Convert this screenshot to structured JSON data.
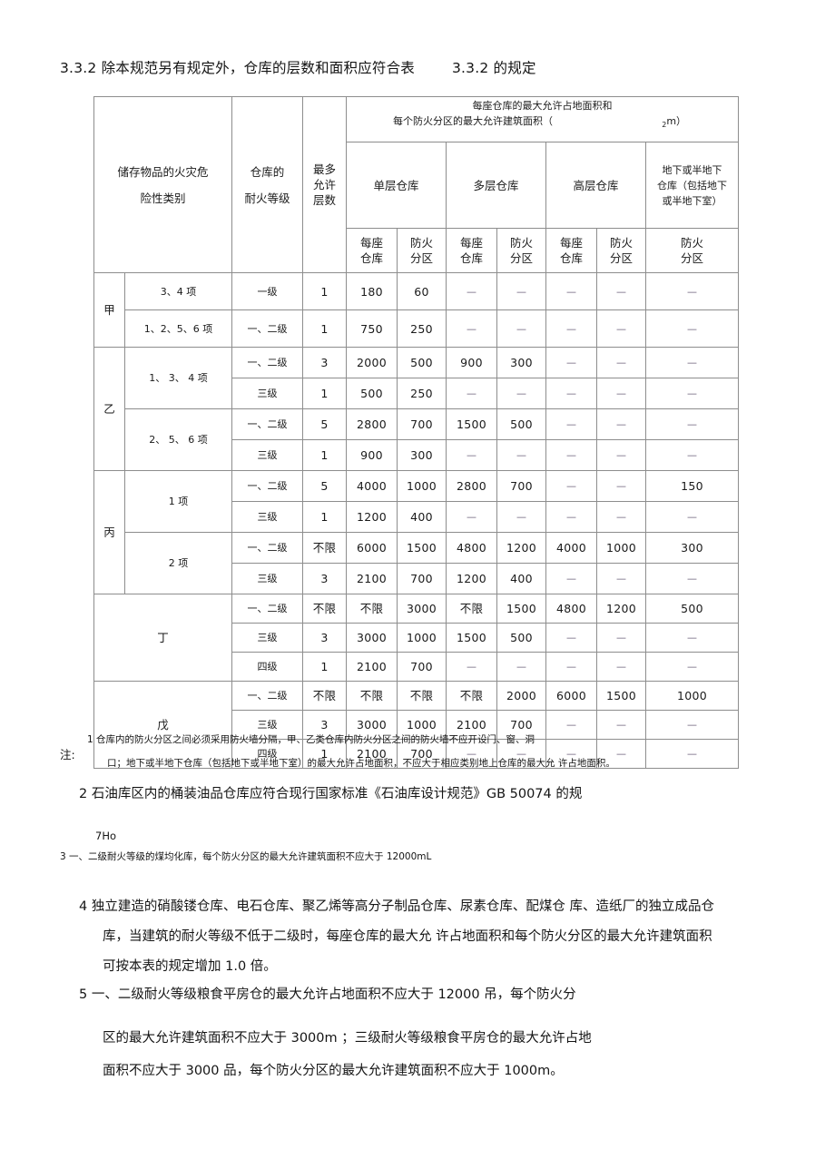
{
  "document": {
    "clause_heading": "3.3.2 除本规范另有规定外，仓库的层数和面积应符合表        3.3.2 的规定"
  },
  "table": {
    "headers": {
      "col_hazard": "储存物品的火灾危\n险性类别",
      "col_hazard_line1": "储存物品的火灾危",
      "col_hazard_line2": "险性类别",
      "col_fire_rating_line1": "仓库的",
      "col_fire_rating_line2": "耐火等级",
      "col_max_floors_line1": "最多",
      "col_max_floors_line2": "允许",
      "col_max_floors_line3": "层数",
      "group_title_line1": "每座仓库的最大允许占地面积和",
      "group_title_line2_a": "每个防火分区的最大允许建筑面积（",
      "group_title_line2_sup": "2",
      "group_title_line2_b": "m）",
      "sub_single": "单层仓库",
      "sub_multi": "多层仓库",
      "sub_high": "高层仓库",
      "sub_basement_line1": "地下或半地下",
      "sub_basement_line2": "仓库（包括地下",
      "sub_basement_line3": "或半地下室）",
      "leaf_each_line1": "每座",
      "leaf_each_line2": "仓库",
      "leaf_zone_line1": "防火",
      "leaf_zone_line2": "分区"
    },
    "groups": [
      {
        "category": "甲",
        "subrows": [
          {
            "items": "3、4 项",
            "items_rowspan": 1,
            "grade": "一级",
            "floors": "1",
            "single_each": "180",
            "single_zone": "60",
            "multi_each": "—",
            "multi_zone": "—",
            "high_each": "—",
            "high_zone": "—",
            "basement_zone": "—"
          },
          {
            "items": "1、2、5、6 项",
            "items_rowspan": 1,
            "grade": "一、二级",
            "floors": "1",
            "single_each": "750",
            "single_zone": "250",
            "multi_each": "—",
            "multi_zone": "—",
            "high_each": "—",
            "high_zone": "—",
            "basement_zone": "—"
          }
        ]
      },
      {
        "category": "乙",
        "subrows": [
          {
            "items": "1、 3、 4 项",
            "items_rowspan": 2,
            "grade": "一、二级",
            "floors": "3",
            "single_each": "2000",
            "single_zone": "500",
            "multi_each": "900",
            "multi_zone": "300",
            "high_each": "—",
            "high_zone": "—",
            "basement_zone": "—"
          },
          {
            "grade": "三级",
            "floors": "1",
            "single_each": "500",
            "single_zone": "250",
            "multi_each": "—",
            "multi_zone": "—",
            "high_each": "—",
            "high_zone": "—",
            "basement_zone": "—"
          },
          {
            "items": "2、 5、 6 项",
            "items_rowspan": 2,
            "grade": "一、二级",
            "floors": "5",
            "single_each": "2800",
            "single_zone": "700",
            "multi_each": "1500",
            "multi_zone": "500",
            "high_each": "—",
            "high_zone": "—",
            "basement_zone": "—"
          },
          {
            "grade": "三级",
            "floors": "1",
            "single_each": "900",
            "single_zone": "300",
            "multi_each": "—",
            "multi_zone": "—",
            "high_each": "—",
            "high_zone": "—",
            "basement_zone": "—"
          }
        ]
      },
      {
        "category": "丙",
        "subrows": [
          {
            "items": "1 项",
            "items_rowspan": 2,
            "grade": "一、二级",
            "floors": "5",
            "single_each": "4000",
            "single_zone": "1000",
            "multi_each": "2800",
            "multi_zone": "700",
            "high_each": "—",
            "high_zone": "—",
            "basement_zone": "150"
          },
          {
            "grade": "三级",
            "floors": "1",
            "single_each": "1200",
            "single_zone": "400",
            "multi_each": "—",
            "multi_zone": "—",
            "high_each": "—",
            "high_zone": "—",
            "basement_zone": "—"
          },
          {
            "items": "2 项",
            "items_rowspan": 2,
            "grade": "一、二级",
            "floors": "不限",
            "single_each": "6000",
            "single_zone": "1500",
            "multi_each": "4800",
            "multi_zone": "1200",
            "high_each": "4000",
            "high_zone": "1000",
            "basement_zone": "300"
          },
          {
            "grade": "三级",
            "floors": "3",
            "single_each": "2100",
            "single_zone": "700",
            "multi_each": "1200",
            "multi_zone": "400",
            "high_each": "—",
            "high_zone": "—",
            "basement_zone": "—"
          }
        ]
      },
      {
        "category": "丁",
        "merged_label": true,
        "subrows": [
          {
            "grade": "一、二级",
            "floors": "不限",
            "single_each": "不限",
            "single_zone": "3000",
            "multi_each": "不限",
            "multi_zone": "1500",
            "high_each": "4800",
            "high_zone": "1200",
            "basement_zone": "500"
          },
          {
            "grade": "三级",
            "floors": "3",
            "single_each": "3000",
            "single_zone": "1000",
            "multi_each": "1500",
            "multi_zone": "500",
            "high_each": "—",
            "high_zone": "—",
            "basement_zone": "—"
          },
          {
            "grade": "四级",
            "floors": "1",
            "single_each": "2100",
            "single_zone": "700",
            "multi_each": "—",
            "multi_zone": "—",
            "high_each": "—",
            "high_zone": "—",
            "basement_zone": "—"
          }
        ]
      },
      {
        "category": "戊",
        "merged_label": true,
        "subrows": [
          {
            "grade": "一、二级",
            "floors": "不限",
            "single_each": "不限",
            "single_zone": "不限",
            "multi_each": "不限",
            "multi_zone": "2000",
            "high_each": "6000",
            "high_zone": "1500",
            "basement_zone": "1000"
          },
          {
            "grade": "三级",
            "floors": "3",
            "single_each": "3000",
            "single_zone": "1000",
            "multi_each": "2100",
            "multi_zone": "700",
            "high_each": "—",
            "high_zone": "—",
            "basement_zone": "—"
          },
          {
            "grade": "四级",
            "floors": "1",
            "single_each": "2100",
            "single_zone": "700",
            "multi_each": "—",
            "multi_zone": "—",
            "high_each": "—",
            "high_zone": "—",
            "basement_zone": "—"
          }
        ]
      }
    ]
  },
  "notes": {
    "label": "注:",
    "n1_line1": "1 仓库内的防火分区之间必须采用防火墙分隔，甲、乙类仓库内防火分区之间的防火墙不应开设门、窗、洞",
    "n1_line2": "口；地下或半地下仓库（包括地下或半地下室）的最大允许占地面积，不应大于相应类别地上仓库的最大允 许占地面积。",
    "n2_line1": "2 石油库区内的桶装油品仓库应符合现行国家标准《石油库设计规范》GB 50074 的规",
    "n2_line2": "7Ho",
    "n3": "3 一、二级耐火等级的煤均化库，每个防火分区的最大允许建筑面积不应大于 12000mL",
    "n4_line1": "4 独立建造的硝酸镂仓库、电石仓库、聚乙烯等高分子制品仓库、尿素仓库、配煤仓 库、造纸厂的独立成品仓",
    "n4_line2": "库，当建筑的耐火等级不低于二级时，每座仓库的最大允 许占地面积和每个防火分区的最大允许建筑面积",
    "n4_line3": "可按本表的规定增加 1.0 倍。",
    "n5_line1": "5 一、二级耐火等级粮食平房仓的最大允许占地面积不应大于 12000 吊，每个防火分",
    "n5_line2": "区的最大允许建筑面积不应大于 3000m ；三级耐火等级粮食平房仓的最大允许占地",
    "n5_line3": "面积不应大于 3000 品，每个防火分区的最大允许建筑面积不应大于 1000m。"
  }
}
